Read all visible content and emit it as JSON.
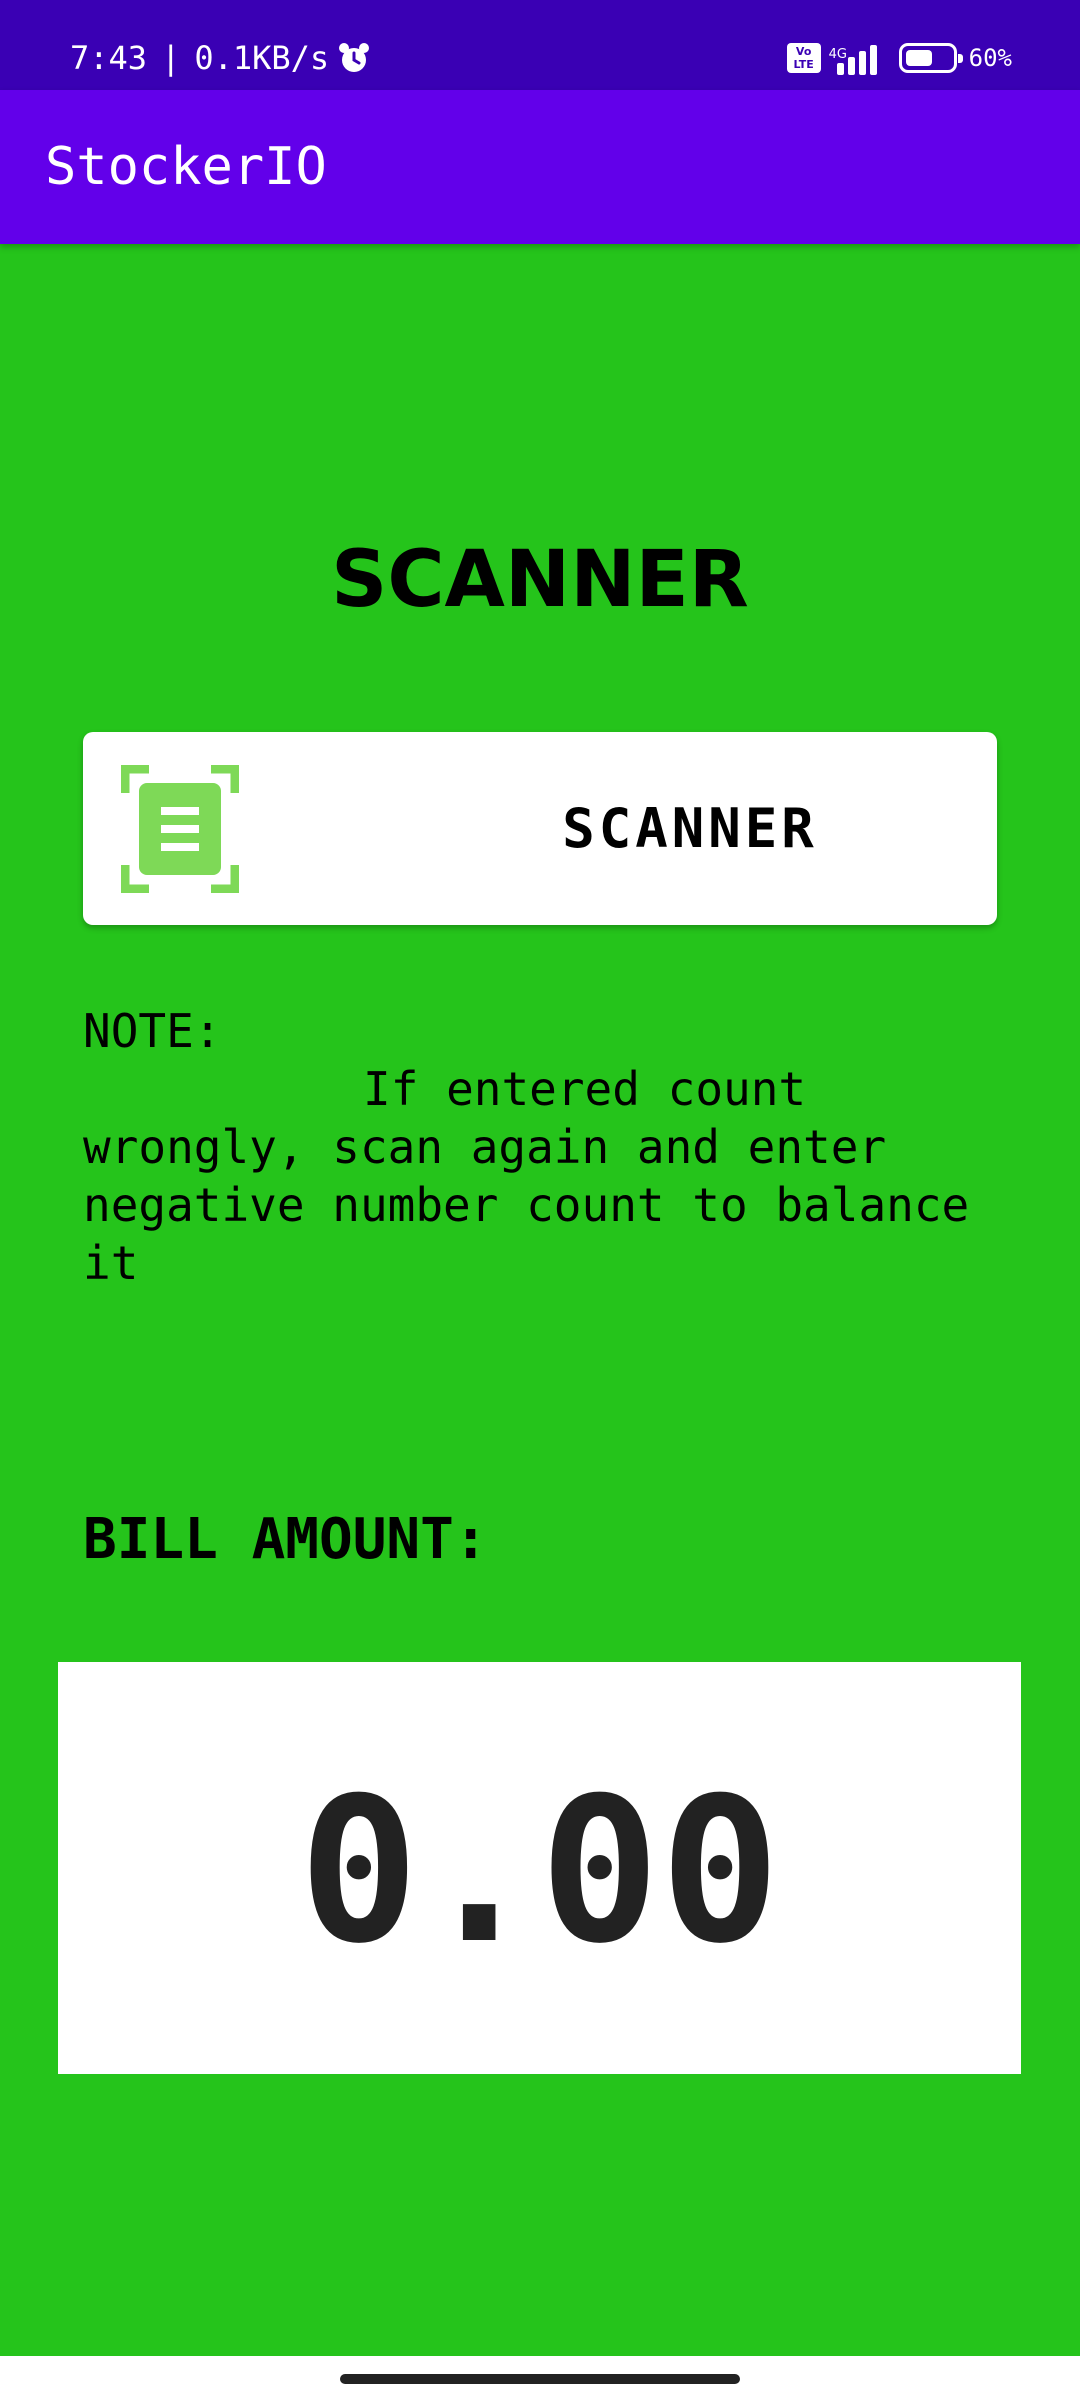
{
  "status_bar": {
    "time": "7:43",
    "separator": "|",
    "speed": "0.1KB/s",
    "volte_top": "Vo",
    "volte_bottom": "LTE",
    "network": "4G",
    "battery_percent": "60%",
    "battery_level": 0.6
  },
  "app_bar": {
    "title": "StockerIO"
  },
  "main": {
    "heading": "SCANNER",
    "scan_button_label": "SCANNER",
    "note_label": "NOTE:",
    "note_text": "If entered count wrongly, scan again and enter negative number count to balance it",
    "bill_label": "BILL AMOUNT:",
    "bill_value": "0.00"
  },
  "colors": {
    "status_bar": "#3a00b4",
    "app_bar": "#6200ea",
    "background": "#25c41b",
    "scan_icon": "#7ed957"
  },
  "icons": {
    "alarm": "alarm-clock-icon",
    "signal": "signal-icon",
    "battery": "battery-icon",
    "scan": "barcode-scan-icon"
  }
}
